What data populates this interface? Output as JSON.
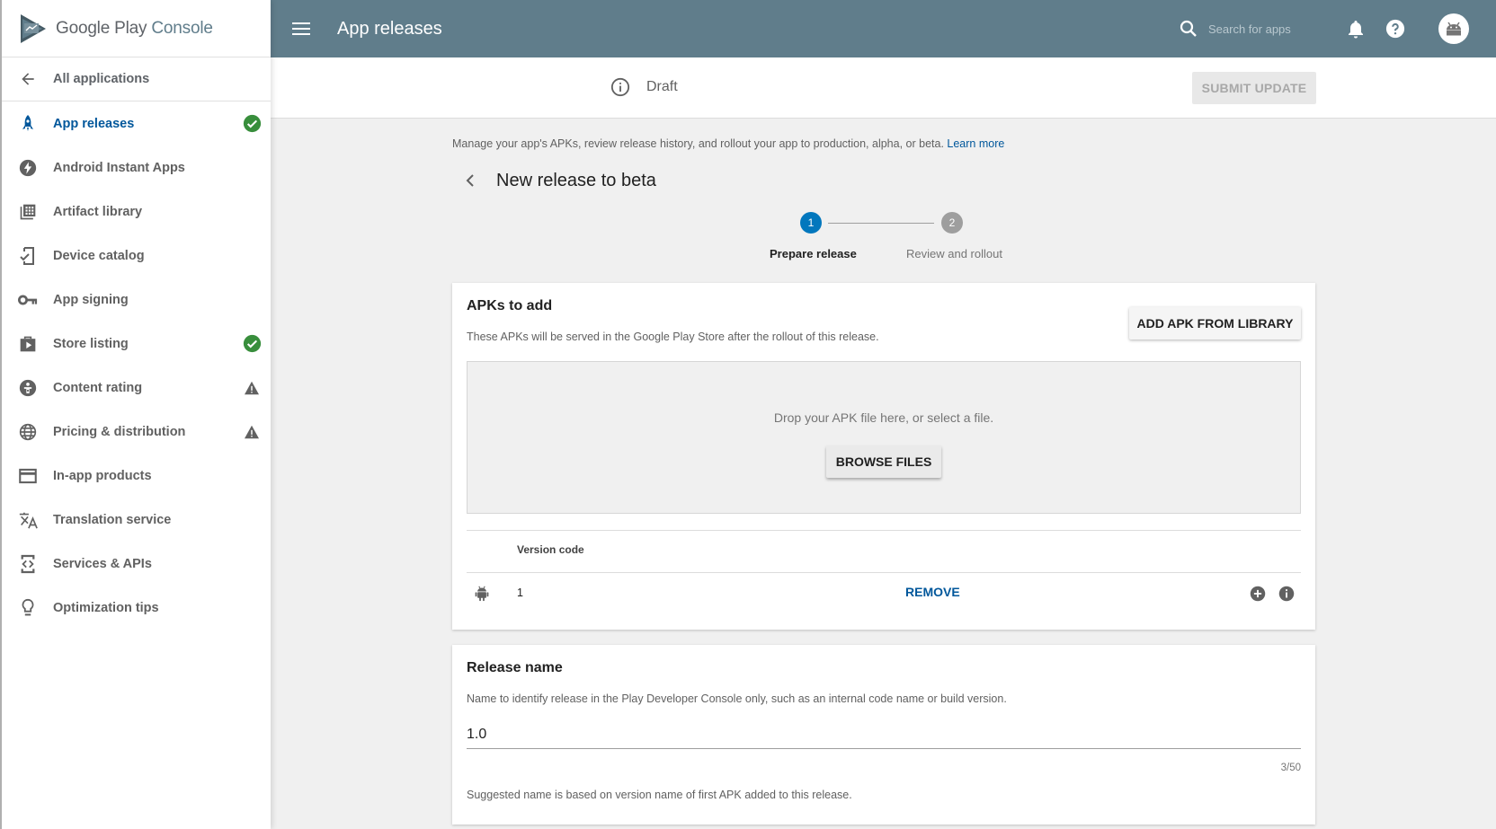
{
  "brand": {
    "name_main": "Google Play",
    "name_sub": "Console"
  },
  "nav_back": {
    "label": "All applications"
  },
  "sidebar": {
    "items": [
      {
        "label": "App releases",
        "icon": "rocket-icon",
        "active": true,
        "status": "check"
      },
      {
        "label": "Android Instant Apps",
        "icon": "bolt-icon",
        "status": ""
      },
      {
        "label": "Artifact library",
        "icon": "library-icon",
        "status": ""
      },
      {
        "label": "Device catalog",
        "icon": "device-check-icon",
        "status": ""
      },
      {
        "label": "App signing",
        "icon": "key-icon",
        "status": ""
      },
      {
        "label": "Store listing",
        "icon": "store-icon",
        "status": "check"
      },
      {
        "label": "Content rating",
        "icon": "rating-icon",
        "status": "warning"
      },
      {
        "label": "Pricing & distribution",
        "icon": "globe-icon",
        "status": "warning"
      },
      {
        "label": "In-app products",
        "icon": "card-icon",
        "status": ""
      },
      {
        "label": "Translation service",
        "icon": "translate-icon",
        "status": ""
      },
      {
        "label": "Services & APIs",
        "icon": "api-icon",
        "status": ""
      },
      {
        "label": "Optimization tips",
        "icon": "lightbulb-icon",
        "status": ""
      }
    ]
  },
  "topbar": {
    "title": "App releases",
    "search_placeholder": "Search for apps"
  },
  "subheader": {
    "status": "Draft",
    "submit_label": "SUBMIT UPDATE"
  },
  "main": {
    "intro": "Manage your app's APKs, review release history, and rollout your app to production, alpha, or beta.",
    "learn_more": "Learn more",
    "release_title": "New release to beta",
    "steps": [
      {
        "number": "1",
        "label": "Prepare release",
        "state": "active"
      },
      {
        "number": "2",
        "label": "Review and rollout",
        "state": "inactive"
      }
    ],
    "apks": {
      "title": "APKs to add",
      "description": "These APKs will be served in the Google Play Store after the rollout of this release.",
      "add_from_library": "ADD APK FROM LIBRARY",
      "drop_text": "Drop your APK file here, or select a file.",
      "browse_label": "BROWSE FILES",
      "column_header": "Version code",
      "rows": [
        {
          "version_code": "1",
          "remove_label": "REMOVE"
        }
      ]
    },
    "release_name": {
      "title": "Release name",
      "description": "Name to identify release in the Play Developer Console only, such as an internal code name or build version.",
      "value": "1.0",
      "counter": "3/50",
      "hint": "Suggested name is based on version name of first APK added to this release."
    }
  },
  "colors": {
    "topbar": "#607d8b",
    "accent": "#01579b",
    "step_active": "#0277bd",
    "success": "#388e3c",
    "warning": "#616161"
  }
}
